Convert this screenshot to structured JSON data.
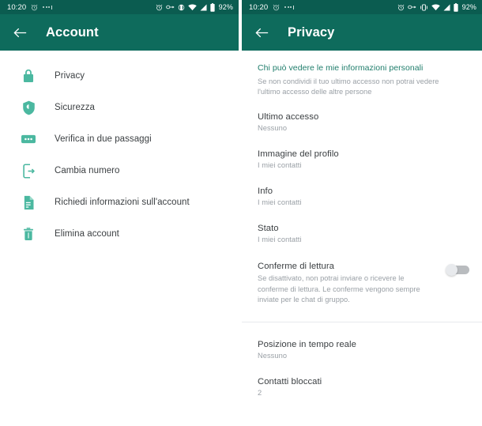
{
  "theme": {
    "status_bar_bg": "#0b5c50",
    "app_bar_bg": "#0e6b5c",
    "accent_green": "#1f7d6b",
    "icon_green": "#4bb8a0",
    "title_text": "#3c4043",
    "sub_text": "#9aa0a6",
    "page_bg": "#ffffff"
  },
  "left_screen": {
    "status_bar": {
      "time": "10:20",
      "battery_percent": "92%",
      "left_icons": [
        "alarm-icon",
        "more-dots-icon"
      ],
      "right_icons": [
        "alarm-icon",
        "link-icon",
        "do-not-disturb-icon",
        "wifi-icon",
        "signal-icon",
        "battery-icon"
      ]
    },
    "app_bar": {
      "back_icon": "back-arrow-icon",
      "title": "Account"
    },
    "items": [
      {
        "icon": "lock-icon",
        "label": "Privacy"
      },
      {
        "icon": "shield-icon",
        "label": "Sicurezza"
      },
      {
        "icon": "two-step-dots-icon",
        "label": "Verifica in due passaggi"
      },
      {
        "icon": "change-number-icon",
        "label": "Cambia numero"
      },
      {
        "icon": "document-request-icon",
        "label": "Richiedi informazioni sull'account"
      },
      {
        "icon": "trash-icon",
        "label": "Elimina account"
      }
    ]
  },
  "right_screen": {
    "status_bar": {
      "time": "10:20",
      "battery_percent": "92%",
      "left_icons": [
        "alarm-icon",
        "more-dots-icon"
      ],
      "right_icons": [
        "alarm-icon",
        "link-icon",
        "vibrate-icon",
        "wifi-icon",
        "signal-icon",
        "battery-icon"
      ]
    },
    "app_bar": {
      "back_icon": "back-arrow-icon",
      "title": "Privacy"
    },
    "section": {
      "title": "Chi può vedere le mie informazioni personali",
      "description": "Se non condividi il tuo ultimo accesso non potrai vedere l'ultimo accesso delle altre persone"
    },
    "rows": [
      {
        "title": "Ultimo accesso",
        "value": "Nessuno"
      },
      {
        "title": "Immagine del profilo",
        "value": "I miei contatti"
      },
      {
        "title": "Info",
        "value": "I miei contatti"
      },
      {
        "title": "Stato",
        "value": "I miei contatti"
      }
    ],
    "read_receipts": {
      "title": "Conferme di lettura",
      "description": "Se disattivato, non potrai inviare o ricevere le conferme di lettura. Le conferme vengono sempre inviate per le chat di gruppo.",
      "toggle_state": "off"
    },
    "rows_bottom": [
      {
        "title": "Posizione in tempo reale",
        "value": "Nessuno"
      },
      {
        "title": "Contatti bloccati",
        "value": "2"
      }
    ]
  }
}
